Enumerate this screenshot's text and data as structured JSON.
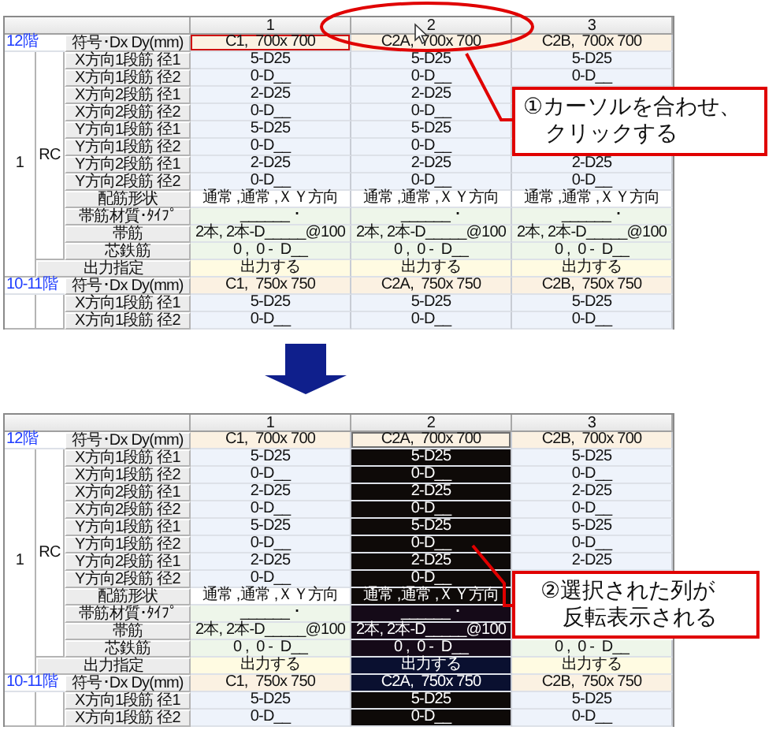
{
  "panels": [
    {
      "columns": [
        {
          "label": "1",
          "selected": false
        },
        {
          "label": "2",
          "selected": false
        },
        {
          "label": "3",
          "selected": false
        }
      ],
      "groups": [
        {
          "floor": "12階",
          "mark": "1",
          "type": "RC",
          "header": {
            "label": "符号･Dx Dy(mm)",
            "cells": [
              {
                "text": "C1,  700x 700",
                "current": true
              },
              {
                "text": "C2A,  700x 700",
                "current": false
              },
              {
                "text": "C2B,  700x 700",
                "current": false
              }
            ]
          },
          "rows": [
            {
              "kind": "rebar",
              "label": "X方向1段筋 径1",
              "cells": [
                "5-D25",
                "5-D25",
                "5-D25"
              ]
            },
            {
              "kind": "rebar",
              "label": "X方向1段筋 径2",
              "cells": [
                "0-D__",
                "0-D__",
                "0-D__"
              ]
            },
            {
              "kind": "rebar",
              "label": "X方向2段筋 径1",
              "cells": [
                "2-D25",
                "2-D25",
                null
              ]
            },
            {
              "kind": "rebar",
              "label": "X方向2段筋 径2",
              "cells": [
                "0-D__",
                "0-D__",
                null
              ]
            },
            {
              "kind": "rebar",
              "label": "Y方向1段筋 径1",
              "cells": [
                "5-D25",
                "5-D25",
                null
              ]
            },
            {
              "kind": "rebar",
              "label": "Y方向1段筋 径2",
              "cells": [
                "0-D__",
                "0-D__",
                null
              ]
            },
            {
              "kind": "rebar",
              "label": "Y方向2段筋 径1",
              "cells": [
                "2-D25",
                "2-D25",
                "2-D25"
              ]
            },
            {
              "kind": "rebar",
              "label": "Y方向2段筋 径2",
              "cells": [
                "0-D__",
                "0-D__",
                "0-D__"
              ]
            },
            {
              "kind": "shape",
              "label": "配筋形状",
              "cells": [
                "通常 ,通常 ,ＸＹ方向",
                "通常 ,通常 ,ＸＹ方向",
                "通常 ,通常 ,ＸＹ方向"
              ]
            },
            {
              "kind": "tie",
              "label": "帯筋材質･ﾀｲﾌﾟ",
              "cells": [
                "______ ･",
                "______ ･",
                "______ ･"
              ]
            },
            {
              "kind": "tie",
              "label": "帯筋",
              "cells": [
                "2本, 2本-D_____@100",
                "2本, 2本-D_____@100",
                "2本, 2本-D_____@100"
              ]
            },
            {
              "kind": "tie",
              "label": "芯鉄筋",
              "cells": [
                "0 ,  0 -  D__",
                "0 ,  0 -  D__",
                "0 ,  0 -  D__"
              ]
            }
          ],
          "output": {
            "label": "出力指定",
            "cells": [
              "出力する",
              "出力する",
              "出力する"
            ]
          }
        },
        {
          "floor": "10-11階",
          "header": {
            "label": "符号･Dx Dy(mm)",
            "cells": [
              {
                "text": "C1,  750x 750",
                "current": false
              },
              {
                "text": "C2A,  750x 750",
                "current": false
              },
              {
                "text": "C2B,  750x 750",
                "current": false
              }
            ]
          },
          "rows": [
            {
              "kind": "rebar",
              "label": "X方向1段筋 径1",
              "cells": [
                "5-D25",
                "5-D25",
                "5-D25"
              ]
            },
            {
              "kind": "rebar",
              "label": "X方向1段筋 径2",
              "cells": [
                "0-D__",
                "0-D__",
                "0-D__"
              ]
            }
          ]
        }
      ],
      "callout": {
        "kind": "click",
        "lines": [
          "①カーソルを合わせ、",
          "クリックする"
        ]
      }
    },
    {
      "columns": [
        {
          "label": "1",
          "selected": false
        },
        {
          "label": "2",
          "selected": true
        },
        {
          "label": "3",
          "selected": false
        }
      ],
      "groups": [
        {
          "floor": "12階",
          "mark": "1",
          "type": "RC",
          "header": {
            "label": "符号･Dx Dy(mm)",
            "cells": [
              {
                "text": "C1,  700x 700",
                "current": false
              },
              {
                "text": "C2A,  700x 700",
                "current": true
              },
              {
                "text": "C2B,  700x 700",
                "current": false
              }
            ]
          },
          "rows": [
            {
              "kind": "rebar",
              "label": "X方向1段筋 径1",
              "cells": [
                "5-D25",
                "5-D25",
                "5-D25"
              ]
            },
            {
              "kind": "rebar",
              "label": "X方向1段筋 径2",
              "cells": [
                "0-D__",
                "0-D__",
                "0-D__"
              ]
            },
            {
              "kind": "rebar",
              "label": "X方向2段筋 径1",
              "cells": [
                "2-D25",
                "2-D25",
                "2-D25"
              ]
            },
            {
              "kind": "rebar",
              "label": "X方向2段筋 径2",
              "cells": [
                "0-D__",
                "0-D__",
                "0-D__"
              ]
            },
            {
              "kind": "rebar",
              "label": "Y方向1段筋 径1",
              "cells": [
                "5-D25",
                "5-D25",
                "5-D25"
              ]
            },
            {
              "kind": "rebar",
              "label": "Y方向1段筋 径2",
              "cells": [
                "0-D__",
                "0-D__",
                "0-D__"
              ]
            },
            {
              "kind": "rebar",
              "label": "Y方向2段筋 径1",
              "cells": [
                "2-D25",
                "2-D25",
                "2-D25"
              ]
            },
            {
              "kind": "rebar",
              "label": "Y方向2段筋 径2",
              "cells": [
                "0-D__",
                "0-D__",
                null
              ]
            },
            {
              "kind": "shape",
              "label": "配筋形状",
              "cells": [
                "通常 ,通常 ,ＸＹ方向",
                "通常 ,通常 ,ＸＹ方向",
                null
              ]
            },
            {
              "kind": "tie",
              "label": "帯筋材質･ﾀｲﾌﾟ",
              "cells": [
                "______ ･",
                "______ ･",
                null
              ]
            },
            {
              "kind": "tie",
              "label": "帯筋",
              "cells": [
                "2本, 2本-D_____@100",
                "2本, 2本-D_____@100",
                null
              ]
            },
            {
              "kind": "tie",
              "label": "芯鉄筋",
              "cells": [
                "0 ,  0 -  D__",
                "0 ,  0 -  D__",
                "0 ,  0 -  D__"
              ]
            }
          ],
          "output": {
            "label": "出力指定",
            "cells": [
              "出力する",
              "出力する",
              "出力する"
            ]
          }
        },
        {
          "floor": "10-11階",
          "header": {
            "label": "符号･Dx Dy(mm)",
            "cells": [
              {
                "text": "C1,  750x 750",
                "current": false
              },
              {
                "text": "C2A,  750x 750",
                "current": false
              },
              {
                "text": "C2B,  750x 750",
                "current": false
              }
            ]
          },
          "rows": [
            {
              "kind": "rebar",
              "label": "X方向1段筋 径1",
              "cells": [
                "5-D25",
                "5-D25",
                "5-D25"
              ]
            },
            {
              "kind": "rebar",
              "label": "X方向1段筋 径2",
              "cells": [
                "0-D__",
                "0-D__",
                "0-D__"
              ]
            }
          ]
        }
      ],
      "callout": {
        "kind": "result",
        "lines": [
          "②選択された列が",
          "反転表示される"
        ]
      }
    }
  ]
}
